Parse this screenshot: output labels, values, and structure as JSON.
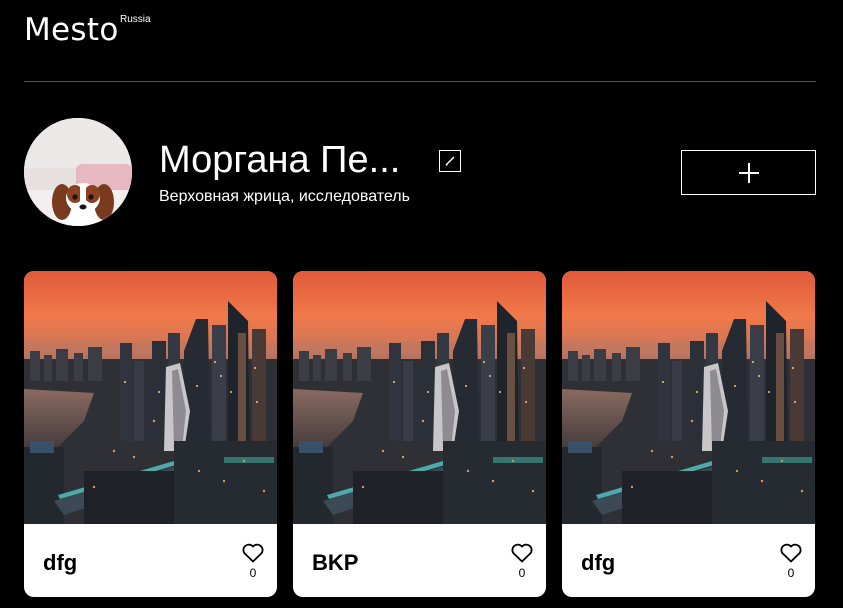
{
  "header": {
    "logo_text": "Mesto",
    "logo_superscript": "Russia"
  },
  "profile": {
    "name": "Моргана Пе...",
    "about": "Верховная жрица, исследователь",
    "avatar_icon": "dog-avatar",
    "edit_icon": "pencil-icon",
    "add_icon": "plus-icon"
  },
  "cards": [
    {
      "title": "dfg",
      "likes": "0",
      "like_icon": "heart-icon"
    },
    {
      "title": "BKP",
      "likes": "0",
      "like_icon": "heart-icon"
    },
    {
      "title": "dfg",
      "likes": "0",
      "like_icon": "heart-icon"
    }
  ],
  "colors": {
    "background": "#000000",
    "card_background": "#ffffff",
    "header_divider": "#545454"
  }
}
